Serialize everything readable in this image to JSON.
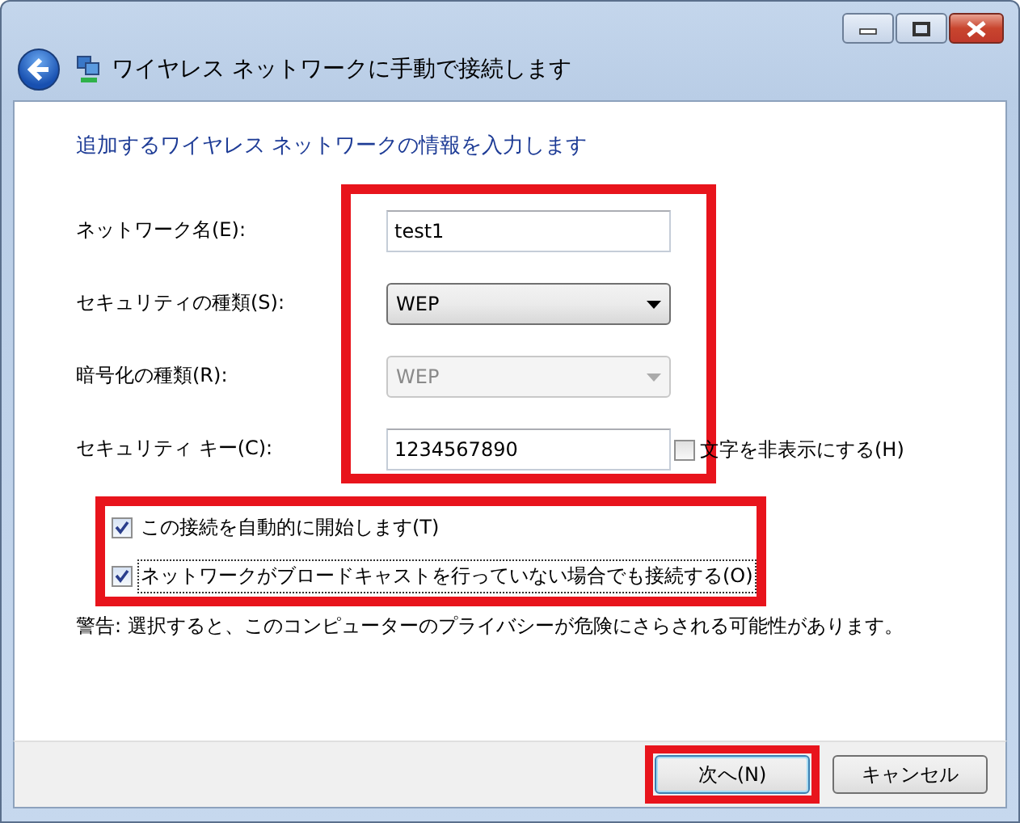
{
  "window": {
    "title": "ワイヤレス ネットワークに手動で接続します"
  },
  "heading": "追加するワイヤレス ネットワークの情報を入力します",
  "fields_highlighted": true,
  "fields": [
    {
      "kind": "text",
      "label": "ネットワーク名(E):",
      "value": "test1"
    },
    {
      "kind": "select",
      "label": "セキュリティの種類(S):",
      "value": "WEP",
      "disabled": false
    },
    {
      "kind": "select",
      "label": "暗号化の種類(R):",
      "value": "WEP",
      "disabled": true
    },
    {
      "kind": "text",
      "label": "セキュリティ キー(C):",
      "value": "1234567890",
      "toggle": {
        "label": "文字を非表示にする(H)",
        "checked": false
      }
    }
  ],
  "options_highlighted": true,
  "options": [
    {
      "label": "この接続を自動的に開始します(T)",
      "checked": true,
      "focused": false
    },
    {
      "label": "ネットワークがブロードキャストを行っていない場合でも接続する(O)",
      "checked": true,
      "focused": true
    }
  ],
  "warning": "警告: 選択すると、このコンピューターのプライバシーが危険にさらされる可能性があります。",
  "buttons": [
    {
      "label": "次へ(N)",
      "default": true,
      "highlighted": true
    },
    {
      "label": "キャンセル",
      "default": false,
      "highlighted": false
    }
  ]
}
